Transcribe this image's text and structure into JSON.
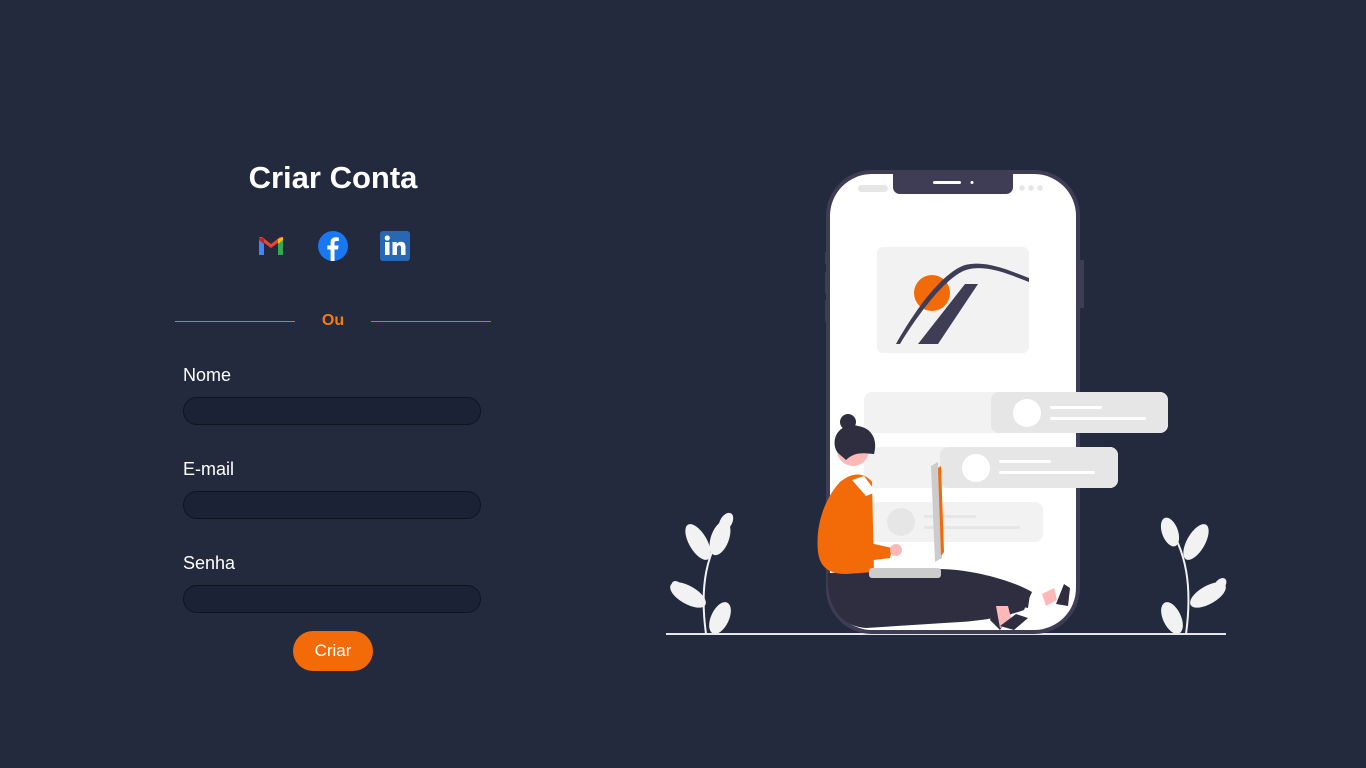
{
  "form": {
    "title": "Criar Conta",
    "divider_text": "Ou",
    "fields": [
      {
        "label": "Nome",
        "value": "",
        "placeholder": ""
      },
      {
        "label": "E-mail",
        "value": "",
        "placeholder": ""
      },
      {
        "label": "Senha",
        "value": "",
        "placeholder": ""
      }
    ],
    "submit_label": "Criar"
  },
  "social": [
    {
      "icon": "gmail-icon"
    },
    {
      "icon": "facebook-icon"
    },
    {
      "icon": "linkedin-icon"
    }
  ],
  "colors": {
    "background": "#232a3e",
    "accent": "#f26b08",
    "input_bg": "#1c2236",
    "text": "#ffffff"
  }
}
